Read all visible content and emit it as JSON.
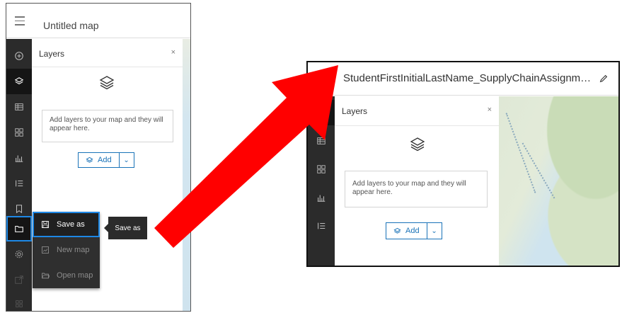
{
  "left": {
    "map_title": "Untitled map",
    "panel": {
      "title": "Layers",
      "close_glyph": "×",
      "empty_text": "Add layers to your map and they will appear here.",
      "add_label": "Add",
      "caret_glyph": "⌄"
    },
    "menu": {
      "save_as": "Save as",
      "new_map": "New map",
      "open_map": "Open map"
    },
    "tooltip": "Save as"
  },
  "right": {
    "map_title": "StudentFirstInitialLastName_SupplyChainAssignm…",
    "panel": {
      "title": "Layers",
      "close_glyph": "×",
      "empty_text": "Add layers to your map and they will appear here.",
      "add_label": "Add",
      "caret_glyph": "⌄"
    }
  },
  "colors": {
    "arrow": "#ff0000",
    "rail": "#2b2b2b",
    "accent": "#1a73b8",
    "focus": "#1e88e5"
  },
  "icons": [
    "menu-icon",
    "add-icon",
    "layers-icon",
    "table-icon",
    "basemap-icon",
    "charts-icon",
    "legend-icon",
    "bookmark-icon",
    "folder-icon",
    "settings-icon",
    "share-icon",
    "save-icon",
    "new-map-icon",
    "open-folder-icon",
    "pencil-icon",
    "close-icon",
    "chevron-down-icon"
  ]
}
